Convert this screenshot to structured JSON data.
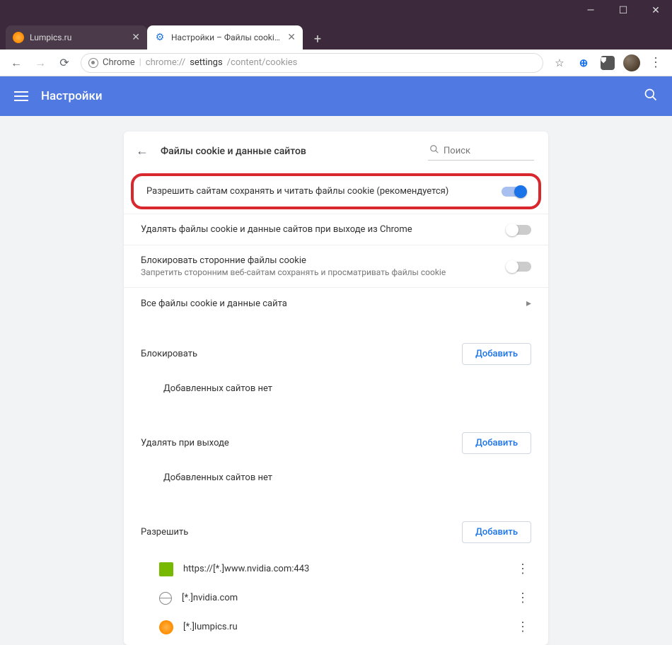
{
  "window": {
    "tabs": [
      {
        "label": "Lumpics.ru",
        "active": false
      },
      {
        "label": "Настройки – Файлы cookie и да",
        "active": true
      }
    ]
  },
  "urlbar": {
    "chip": "Chrome",
    "url_prefix": "chrome://",
    "url_main": "settings",
    "url_suffix": "/content/cookies"
  },
  "header": {
    "title": "Настройки"
  },
  "page": {
    "title": "Файлы cookie и данные сайтов",
    "search_placeholder": "Поиск",
    "toggles": {
      "allow": {
        "label": "Разрешить сайтам сохранять и читать файлы cookie (рекомендуется)",
        "on": true
      },
      "clear_on_exit": {
        "label": "Удалять файлы cookie и данные сайтов при выходе из Chrome",
        "on": false
      },
      "block_third": {
        "label": "Блокировать сторонние файлы cookie",
        "sub": "Запретить сторонним веб-сайтам сохранять и просматривать файлы cookie",
        "on": false
      }
    },
    "all_data": "Все файлы cookie и данные сайта",
    "sections": {
      "block": {
        "title": "Блокировать",
        "add": "Добавить",
        "empty": "Добавленных сайтов нет"
      },
      "exit": {
        "title": "Удалять при выходе",
        "add": "Добавить",
        "empty": "Добавленных сайтов нет"
      },
      "allow": {
        "title": "Разрешить",
        "add": "Добавить"
      }
    },
    "allow_sites": [
      {
        "url": "https://[*.]www.nvidia.com:443",
        "icon": "nvidia"
      },
      {
        "url": "[*.]nvidia.com",
        "icon": "globe"
      },
      {
        "url": "[*.]lumpics.ru",
        "icon": "orange"
      }
    ]
  }
}
